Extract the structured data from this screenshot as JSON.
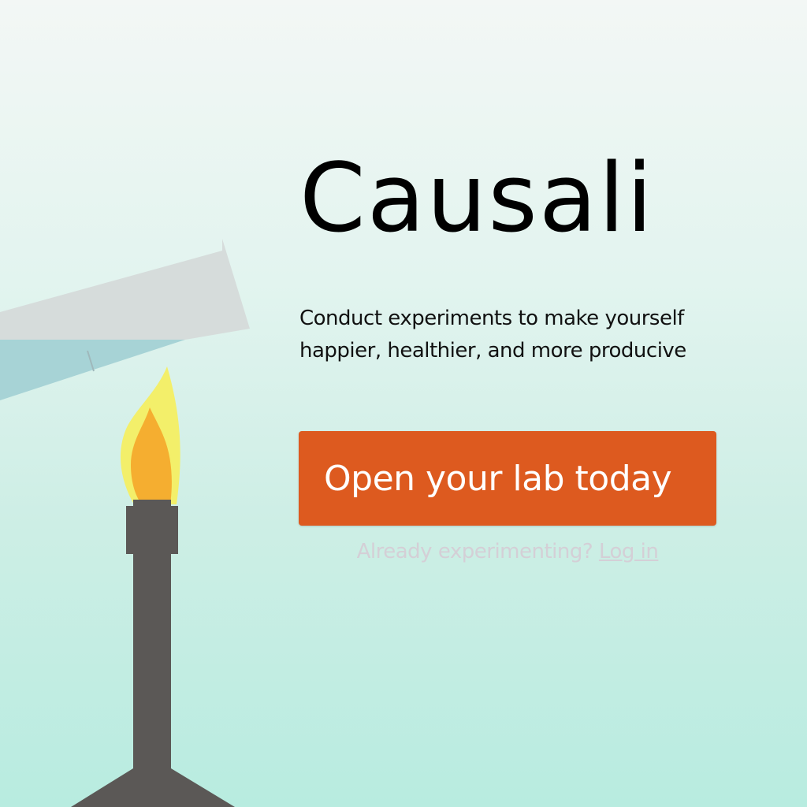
{
  "app": {
    "title": "Causali",
    "tagline": "Conduct experiments to make yourself happier, healthier, and more producive"
  },
  "cta": {
    "label": "Open your lab today"
  },
  "login": {
    "prompt": "Already experimenting?",
    "link_label": "Log in"
  },
  "illustration": {
    "objects": [
      "test-tube",
      "liquid",
      "flame",
      "bunsen-burner"
    ]
  },
  "colors": {
    "background_top": "#f3f7f5",
    "background_bottom": "#b8ece0",
    "button": "#dd5a1f",
    "button_text": "#ffffff",
    "title_text": "#000000",
    "login_text": "#d4cfd6",
    "tube_glass": "#d6dcdb",
    "liquid": "#a7d3d6",
    "flame_outer": "#f3ef6a",
    "flame_inner": "#f5ae30",
    "burner": "#5b5856"
  }
}
